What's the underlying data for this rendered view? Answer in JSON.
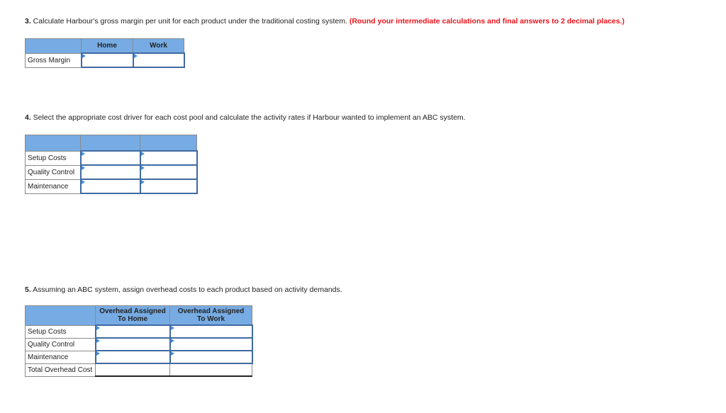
{
  "questions": {
    "q3": {
      "number": "3.",
      "text": " Calculate Harbour's gross margin per unit for each product under the traditional costing system. ",
      "note": "(Round your intermediate calculations and final answers to 2 decimal places.)"
    },
    "q4": {
      "number": "4.",
      "text": " Select the appropriate cost driver for each cost pool and calculate the activity rates if Harbour wanted to implement an ABC system."
    },
    "q5": {
      "number": "5.",
      "text": " Assuming an ABC system, assign overhead costs to each product based on activity demands."
    }
  },
  "table_gross_margin": {
    "headers": [
      "",
      "Home",
      "Work"
    ],
    "rows": [
      {
        "label": "Gross Margin",
        "values": [
          "",
          ""
        ]
      }
    ]
  },
  "table_activity_rates": {
    "headers": [
      "",
      "",
      ""
    ],
    "rows": [
      {
        "label": "Setup Costs",
        "values": [
          "",
          ""
        ]
      },
      {
        "label": "Quality Control",
        "values": [
          "",
          ""
        ]
      },
      {
        "label": "Maintenance",
        "values": [
          "",
          ""
        ]
      }
    ]
  },
  "table_overhead": {
    "headers": [
      "",
      "Overhead Assigned\nTo Home",
      "Overhead Assigned\nTo Work"
    ],
    "header_lines": [
      [
        "Overhead Assigned",
        "To Home"
      ],
      [
        "Overhead Assigned",
        "To Work"
      ]
    ],
    "rows": [
      {
        "label": "Setup Costs",
        "values": [
          "",
          ""
        ]
      },
      {
        "label": "Quality Control",
        "values": [
          "",
          ""
        ]
      },
      {
        "label": "Maintenance",
        "values": [
          "",
          ""
        ]
      },
      {
        "label": "Total Overhead Cost",
        "values": [
          "",
          ""
        ]
      }
    ]
  },
  "colors": {
    "header_fill": "#77abe3",
    "input_border": "#3f6aa1",
    "note_red": "#e8141b"
  }
}
